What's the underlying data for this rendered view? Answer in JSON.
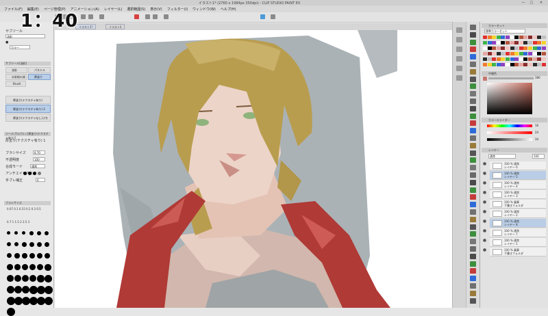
{
  "timer": "1：40",
  "window": {
    "title": "イラスト1* (2760 x 1984px 350dpi) - CLIP STUDIO PAINT EX",
    "controls": [
      "—",
      "□",
      "✕"
    ]
  },
  "menu": [
    "ファイル(F)",
    "編集(E)",
    "ページ管理(P)",
    "アニメーション(A)",
    "レイヤー(L)",
    "選択範囲(S)",
    "表示(V)",
    "フィルター(I)",
    "ウィンドウ(W)",
    "ヘルプ(H)"
  ],
  "document_tabs": [
    "イラスト1*",
    "イラスト2"
  ],
  "left_panel": {
    "header1": "サブツール",
    "brush_label": "油彩",
    "color_label": "カラー",
    "subtool_header": "サブツール[油彩]",
    "tabs": [
      "油彩",
      "パステル",
      "水彩絵の具",
      "厚塗り"
    ],
    "brush_name": "Brush",
    "subtools": [
      "厚塗り(テクスチャ有り)",
      "厚塗り(テクスチャ有り) 2",
      "厚塗り(テクスチャなし)ぶち"
    ],
    "tool_prop_header": "ツールプロパティ[厚塗り(テクスチャ有り)]",
    "tool_name": "厚塗り(テクスチャ有り) 1",
    "props": [
      {
        "label": "ブラシサイズ",
        "value": "8.70"
      },
      {
        "label": "不透明度",
        "value": "100"
      },
      {
        "label": "合成モード",
        "value": "通常"
      },
      {
        "label": "アンチエイリアス",
        "value": ""
      },
      {
        "label": "手ブレ補正",
        "value": "0"
      }
    ],
    "brush_size_header": "ブラシサイズ",
    "brush_sizes": [
      "0.07",
      "0.1",
      "0.15",
      "0.2",
      "0.3",
      "0.5",
      "0.7",
      "1",
      "1.5",
      "2",
      "2.5",
      "3"
    ]
  },
  "right_panel": {
    "color_set_header": "カラーセット",
    "color_set_name": "標準カラーセット",
    "intermediate_header": "中間色",
    "approx_header": "近似色",
    "approx_value": "180",
    "slider_header": "カラースライダー",
    "slider_values": [
      "16",
      "24",
      "34"
    ],
    "layer_header": "レイヤー",
    "blend_mode": "通常",
    "opacity": "100",
    "layers": [
      {
        "pct": "100 %",
        "mode": "通常",
        "name": "レイヤー 6",
        "selected": false
      },
      {
        "pct": "100 %",
        "mode": "通常",
        "name": "レイヤー 5",
        "selected": true
      },
      {
        "pct": "100 %",
        "mode": "通常",
        "name": "レイヤー 4",
        "selected": false
      },
      {
        "pct": "100 %",
        "mode": "通常",
        "name": "レイヤー 3",
        "selected": false
      },
      {
        "pct": "100 %",
        "mode": "乗算",
        "name": "下書きフォルダ",
        "selected": false
      },
      {
        "pct": "100 %",
        "mode": "通常",
        "name": "レイヤー 2",
        "selected": false
      },
      {
        "pct": "100 %",
        "mode": "通常",
        "name": "レイヤー 8",
        "selected": true
      },
      {
        "pct": "100 %",
        "mode": "通常",
        "name": "レイヤー 7",
        "selected": false
      },
      {
        "pct": "100 %",
        "mode": "通常",
        "name": "レイヤー 1",
        "selected": false
      },
      {
        "pct": "100 %",
        "mode": "乗算",
        "name": "下書きフォルダ",
        "selected": false
      }
    ]
  },
  "colors": {
    "accent": "#4a78b5",
    "selected_layer": "#b9cde6",
    "jacket": "#b03a36",
    "hair": "#b99d4f",
    "background_gray": "#a9b0b3"
  }
}
